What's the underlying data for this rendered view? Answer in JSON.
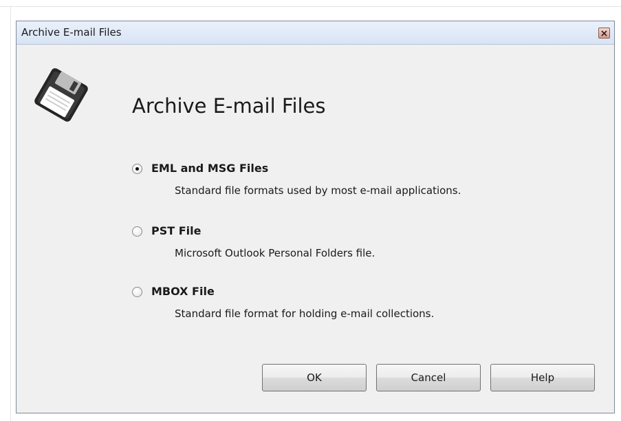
{
  "window": {
    "title": "Archive E-mail Files"
  },
  "dialog": {
    "heading": "Archive E-mail Files",
    "icon": "floppy-disk-icon",
    "options": [
      {
        "label": "EML and MSG Files",
        "description": "Standard file formats used by most e-mail applications.",
        "selected": true
      },
      {
        "label": "PST File",
        "description": "Microsoft Outlook Personal Folders file.",
        "selected": false
      },
      {
        "label": "MBOX File",
        "description": "Standard file format for holding e-mail collections.",
        "selected": false
      }
    ]
  },
  "buttons": {
    "ok": "OK",
    "cancel": "Cancel",
    "help": "Help"
  },
  "colors": {
    "titlebar": "#dde7f5",
    "dialog_background": "#f0f0f0",
    "close_button": "#d9a497"
  }
}
